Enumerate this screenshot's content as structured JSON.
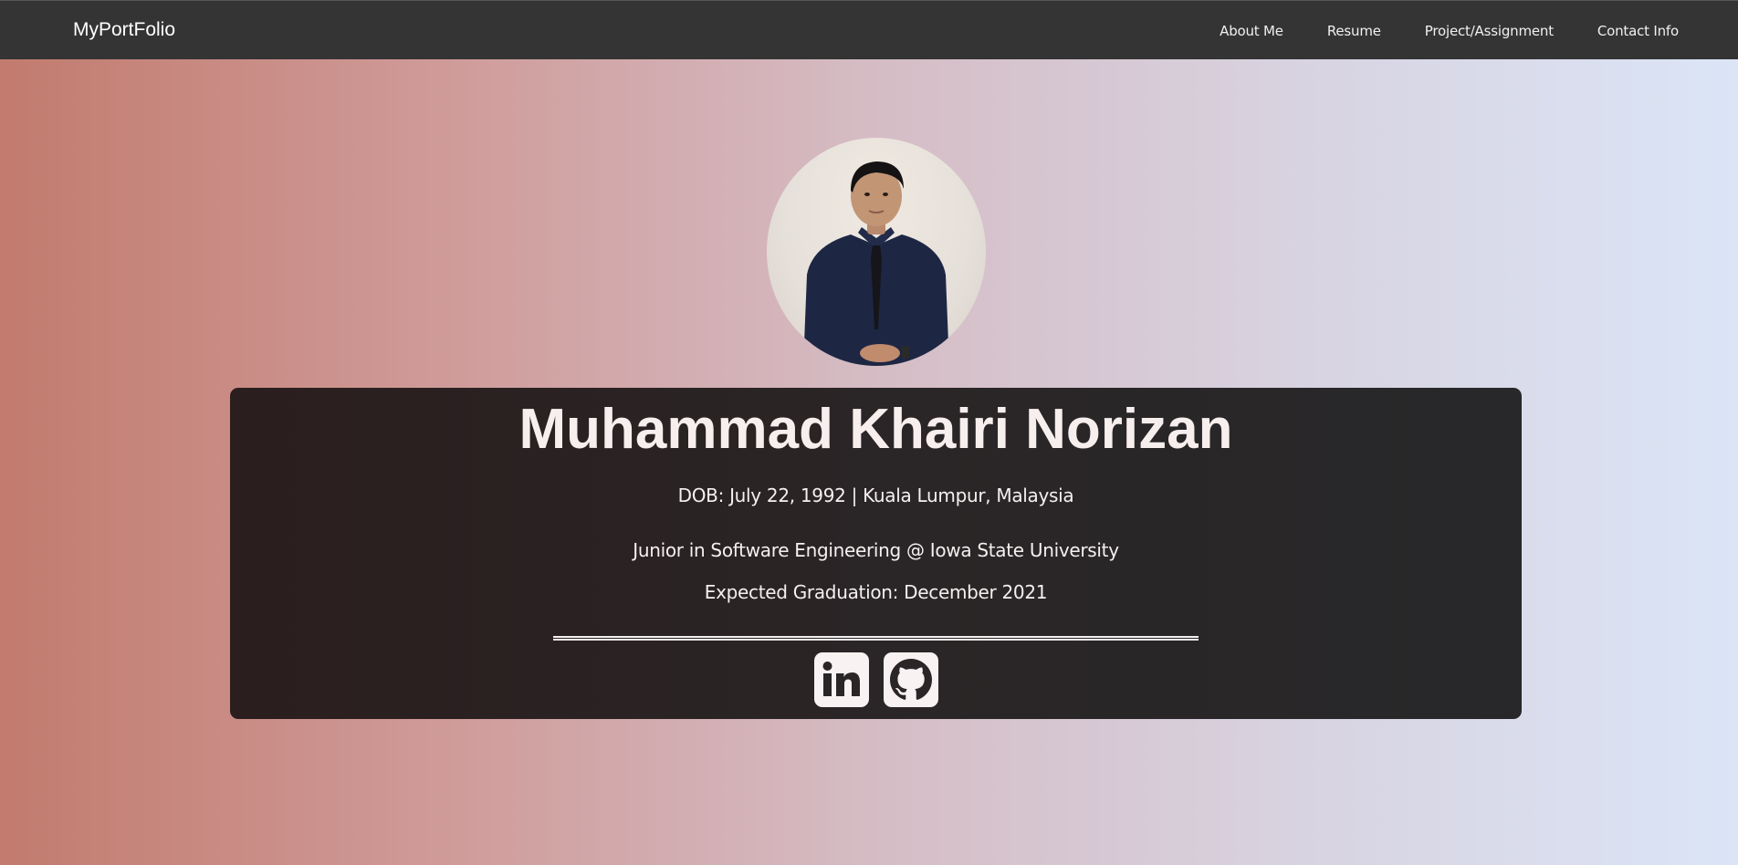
{
  "nav": {
    "brand": "MyPortFolio",
    "links": [
      {
        "label": "About Me"
      },
      {
        "label": "Resume"
      },
      {
        "label": "Project/Assignment"
      },
      {
        "label": "Contact Info"
      }
    ]
  },
  "profile": {
    "name": "Muhammad Khairi Norizan",
    "dob_line": "DOB: July 22, 1992 | Kuala Lumpur, Malaysia",
    "school_line": "Junior in Software Engineering @ Iowa State University",
    "graduation_line": "Expected Graduation: December 2021"
  },
  "socials": [
    {
      "icon": "linkedin-icon"
    },
    {
      "icon": "github-icon"
    }
  ],
  "colors": {
    "navbar_bg": "#343434",
    "card_bg": "#2a2526",
    "gradient_left": "#c27b6e",
    "gradient_right": "#dbe5f6",
    "icon_bg": "#f8f2f2"
  }
}
